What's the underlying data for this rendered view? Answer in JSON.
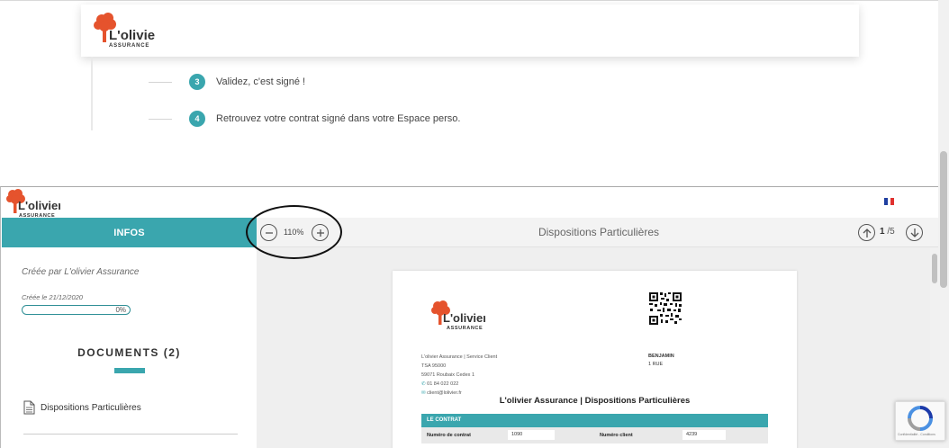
{
  "brand": {
    "name": "L'olivier",
    "tagline": "ASSURANCE",
    "accent_color": "#3aa6ae",
    "logo_color": "#e5532d"
  },
  "background_page": {
    "steps": [
      {
        "number": "3",
        "text": "Validez, c'est signé !"
      },
      {
        "number": "4",
        "text": "Retrouvez votre contrat signé dans votre Espace perso."
      }
    ]
  },
  "signing_frame": {
    "language_flag": "fr-flag-icon",
    "infos_tab": "INFOS",
    "toolbar": {
      "zoom_value": "110%",
      "zoom_out_icon": "minus-circle-icon",
      "zoom_in_icon": "plus-circle-icon",
      "document_title": "Dispositions Particulières",
      "current_page": "1",
      "page_separator": "/",
      "total_pages": "5",
      "prev_page_icon": "arrow-up-circle-icon",
      "next_page_icon": "arrow-down-circle-icon"
    },
    "sidebar": {
      "created_by": "Créée par L'olivier Assurance",
      "created_on": "Créée le 21/12/2020",
      "progress_percent": 0,
      "progress_label": "0%",
      "documents_title": "DOCUMENTS (2)",
      "documents": [
        {
          "label": "Dispositions Particulières",
          "icon": "document-icon"
        }
      ]
    },
    "document_preview": {
      "sender_lines": [
        "L'olivier Assurance | Service Client",
        "TSA 95000",
        "59071 Roubaix Cedex 1"
      ],
      "phone": "01 84 022 022",
      "email": "client@lolivier.fr",
      "recipient_name": "BENJAMIN",
      "recipient_address": "1 RUE",
      "title": "L'olivier Assurance | Dispositions Particulières",
      "section_header": "LE CONTRAT",
      "fields": [
        {
          "label": "Numéro de contrat",
          "value": "1090"
        },
        {
          "label": "Numéro client",
          "value": "4239"
        }
      ]
    }
  },
  "recaptcha": {
    "terms": "Confidentialité - Conditions"
  }
}
